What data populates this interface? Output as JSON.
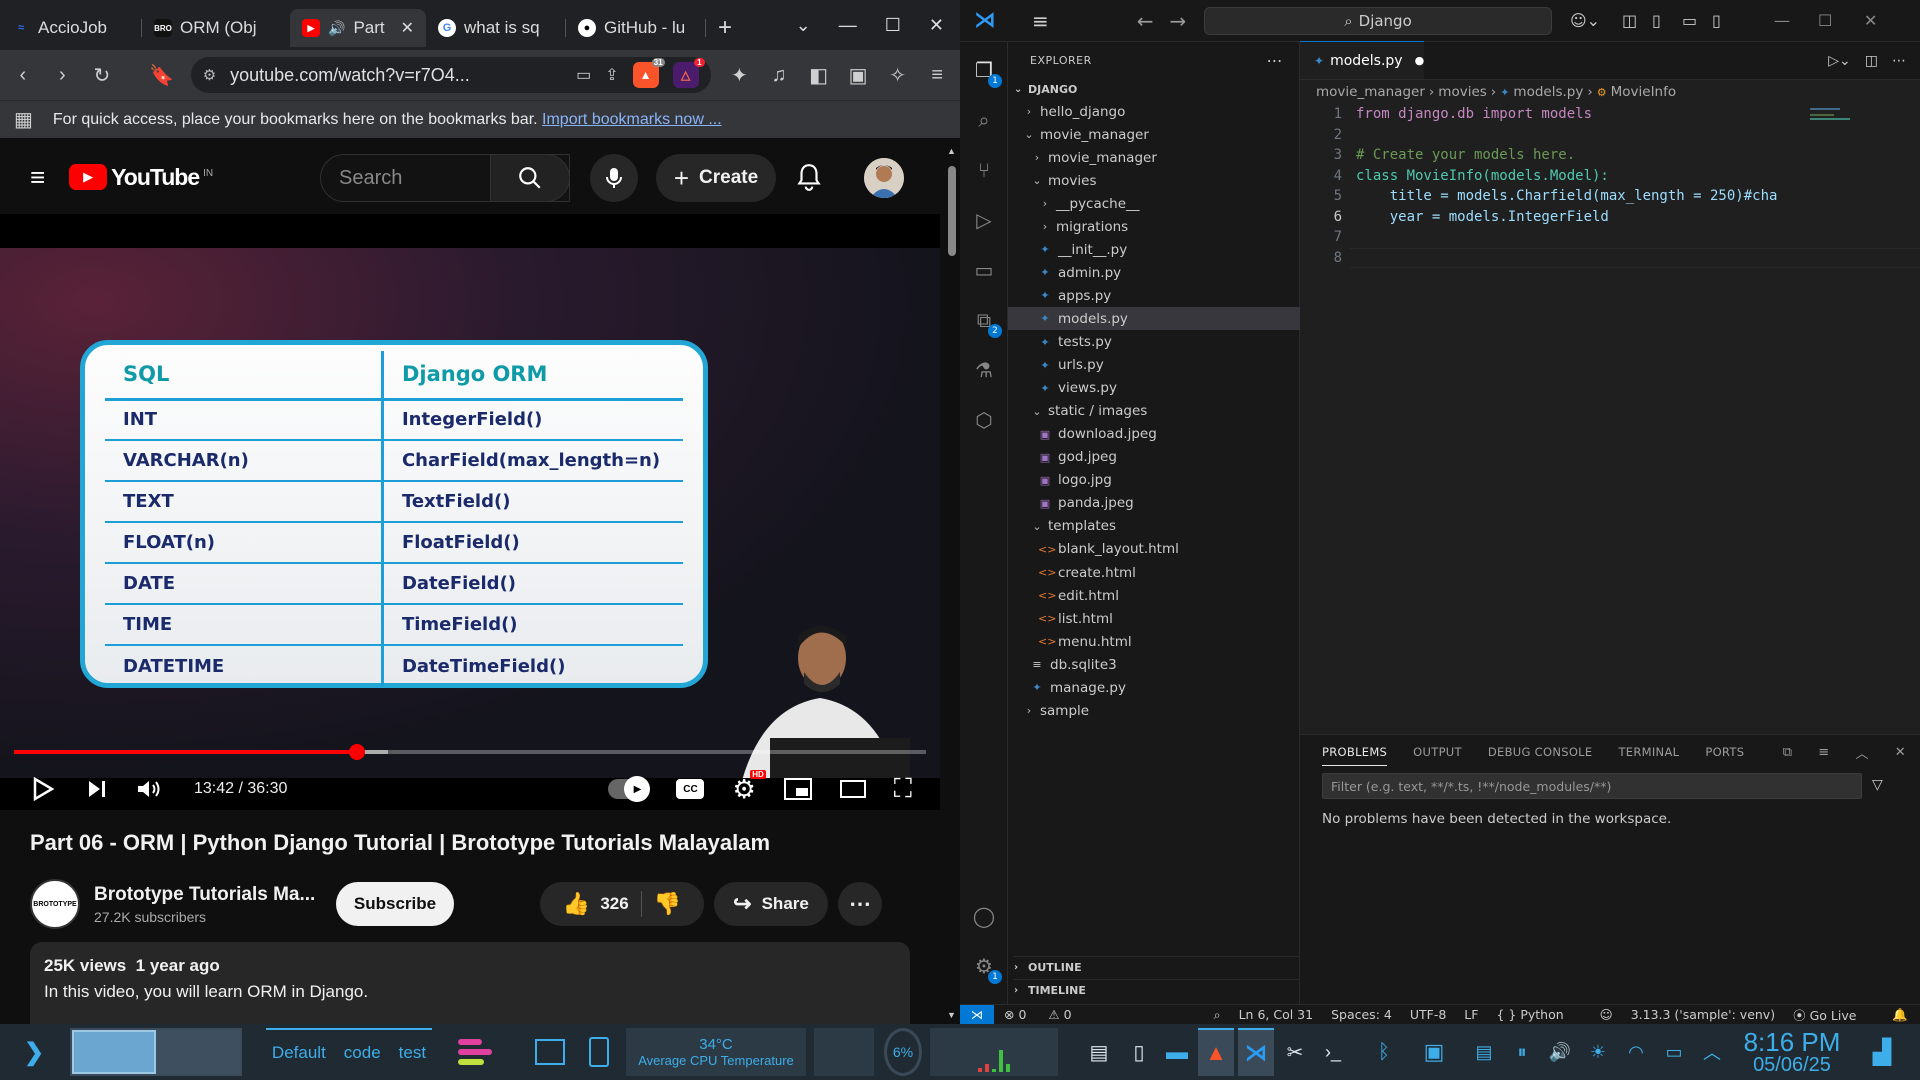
{
  "browser": {
    "tabs": [
      {
        "label": "AccioJob",
        "icon": "acciojob-icon",
        "active": false
      },
      {
        "label": "ORM (Obj",
        "icon": "bro-icon",
        "active": false
      },
      {
        "label": "Part",
        "icon": "youtube-icon",
        "active": true
      },
      {
        "label": "what is sq",
        "icon": "google-icon",
        "active": false
      },
      {
        "label": "GitHub - lu",
        "icon": "github-icon",
        "active": false
      }
    ],
    "url": "youtube.com/watch?v=r7O4...",
    "brave_badge": "31",
    "alert_badge": "1",
    "bookmarks_text": "For quick access, place your bookmarks here on the bookmarks bar.",
    "bookmarks_link": "Import bookmarks now ..."
  },
  "youtube": {
    "logo_text": "YouTube",
    "region": "IN",
    "search_placeholder": "Search",
    "create_label": "Create",
    "video": {
      "table_headers": [
        "SQL",
        "Django ORM"
      ],
      "table_rows": [
        [
          "INT",
          "IntegerField()"
        ],
        [
          "VARCHAR(n)",
          "CharField(max_length=n)"
        ],
        [
          "TEXT",
          "TextField()"
        ],
        [
          "FLOAT(n)",
          "FloatField()"
        ],
        [
          "DATE",
          "DateField()"
        ],
        [
          "TIME",
          "TimeField()"
        ],
        [
          "DATETIME",
          "DateTimeField()"
        ]
      ],
      "time_current": "13:42",
      "time_total": "36:30",
      "timecode": "13:42 / 36:30",
      "progress_fraction": 0.3758,
      "hd_badge": "HD"
    },
    "title": "Part 06 - ORM | Python Django Tutorial | Brototype Tutorials Malayalam",
    "channel": {
      "name": "Brototype Tutorials Ma...",
      "subscribers": "27.2K subscribers",
      "logo_text": "BROTOTYPE"
    },
    "subscribe_label": "Subscribe",
    "likes": "326",
    "share_label": "Share",
    "views_date": "25K views  1 year ago",
    "description": "In this video, you will learn ORM in Django."
  },
  "vscode": {
    "search_text": "Django",
    "explorer_label": "EXPLORER",
    "root_folder": "DJANGO",
    "tree": [
      {
        "label": "hello_django",
        "type": "folder",
        "depth": 0,
        "open": false
      },
      {
        "label": "movie_manager",
        "type": "folder",
        "depth": 0,
        "open": true
      },
      {
        "label": "movie_manager",
        "type": "folder",
        "depth": 1,
        "open": false
      },
      {
        "label": "movies",
        "type": "folder",
        "depth": 1,
        "open": true
      },
      {
        "label": "__pycache__",
        "type": "folder",
        "depth": 2,
        "open": false
      },
      {
        "label": "migrations",
        "type": "folder",
        "depth": 2,
        "open": false
      },
      {
        "label": "__init__.py",
        "type": "py",
        "depth": 2
      },
      {
        "label": "admin.py",
        "type": "py",
        "depth": 2
      },
      {
        "label": "apps.py",
        "type": "py",
        "depth": 2
      },
      {
        "label": "models.py",
        "type": "py",
        "depth": 2,
        "selected": true
      },
      {
        "label": "tests.py",
        "type": "py",
        "depth": 2
      },
      {
        "label": "urls.py",
        "type": "py",
        "depth": 2
      },
      {
        "label": "views.py",
        "type": "py",
        "depth": 2
      },
      {
        "label": "static / images",
        "type": "folder",
        "depth": 1,
        "open": true
      },
      {
        "label": "download.jpeg",
        "type": "img",
        "depth": 2
      },
      {
        "label": "god.jpeg",
        "type": "img",
        "depth": 2
      },
      {
        "label": "logo.jpg",
        "type": "img",
        "depth": 2
      },
      {
        "label": "panda.jpeg",
        "type": "img",
        "depth": 2
      },
      {
        "label": "templates",
        "type": "folder",
        "depth": 1,
        "open": true
      },
      {
        "label": "blank_layout.html",
        "type": "html",
        "depth": 2
      },
      {
        "label": "create.html",
        "type": "html",
        "depth": 2
      },
      {
        "label": "edit.html",
        "type": "html",
        "depth": 2
      },
      {
        "label": "list.html",
        "type": "html",
        "depth": 2
      },
      {
        "label": "menu.html",
        "type": "html",
        "depth": 2
      },
      {
        "label": "db.sqlite3",
        "type": "db",
        "depth": 1
      },
      {
        "label": "manage.py",
        "type": "py",
        "depth": 1
      },
      {
        "label": "sample",
        "type": "folder",
        "depth": 0,
        "open": false
      }
    ],
    "outline_label": "OUTLINE",
    "timeline_label": "TIMELINE",
    "tab_label": "models.py",
    "breadcrumbs": [
      "movie_manager",
      "movies",
      "models.py",
      "MovieInfo"
    ],
    "code": [
      {
        "n": "1",
        "text": "from django.db import models"
      },
      {
        "n": "2",
        "text": ""
      },
      {
        "n": "3",
        "text": "# Create your models here."
      },
      {
        "n": "4",
        "text": "class MovieInfo(models.Model):"
      },
      {
        "n": "5",
        "text": "    title = models.Charfield(max_length = 250)#cha"
      },
      {
        "n": "6",
        "text": "    year = models.IntegerField"
      },
      {
        "n": "7",
        "text": ""
      },
      {
        "n": "8",
        "text": ""
      }
    ],
    "panel_tabs": [
      "PROBLEMS",
      "OUTPUT",
      "DEBUG CONSOLE",
      "TERMINAL",
      "PORTS"
    ],
    "filter_placeholder": "Filter (e.g. text, **/*.ts, !**/node_modules/**)",
    "problems_message": "No problems have been detected in the workspace.",
    "activity_badges": {
      "explorer": "1",
      "extensions": "2",
      "settings": "1"
    },
    "status": {
      "errors": "0",
      "warnings": "0",
      "position": "Ln 6, Col 31",
      "spaces": "Spaces: 4",
      "encoding": "UTF-8",
      "eol": "LF",
      "language": "Python",
      "interpreter": "3.13.3 ('sample': venv)",
      "golive": "Go Live"
    }
  },
  "taskbar": {
    "activities": [
      "Default",
      "code",
      "test"
    ],
    "cpu_temp": "34°C",
    "cpu_label": "Average CPU Temperature",
    "cpu_percent": "6%",
    "time": "8:16 PM",
    "date": "05/06/25"
  },
  "colors": {
    "yt_red": "#ff0000",
    "vscode_blue": "#0078d4",
    "table_border": "#22a6d6"
  }
}
